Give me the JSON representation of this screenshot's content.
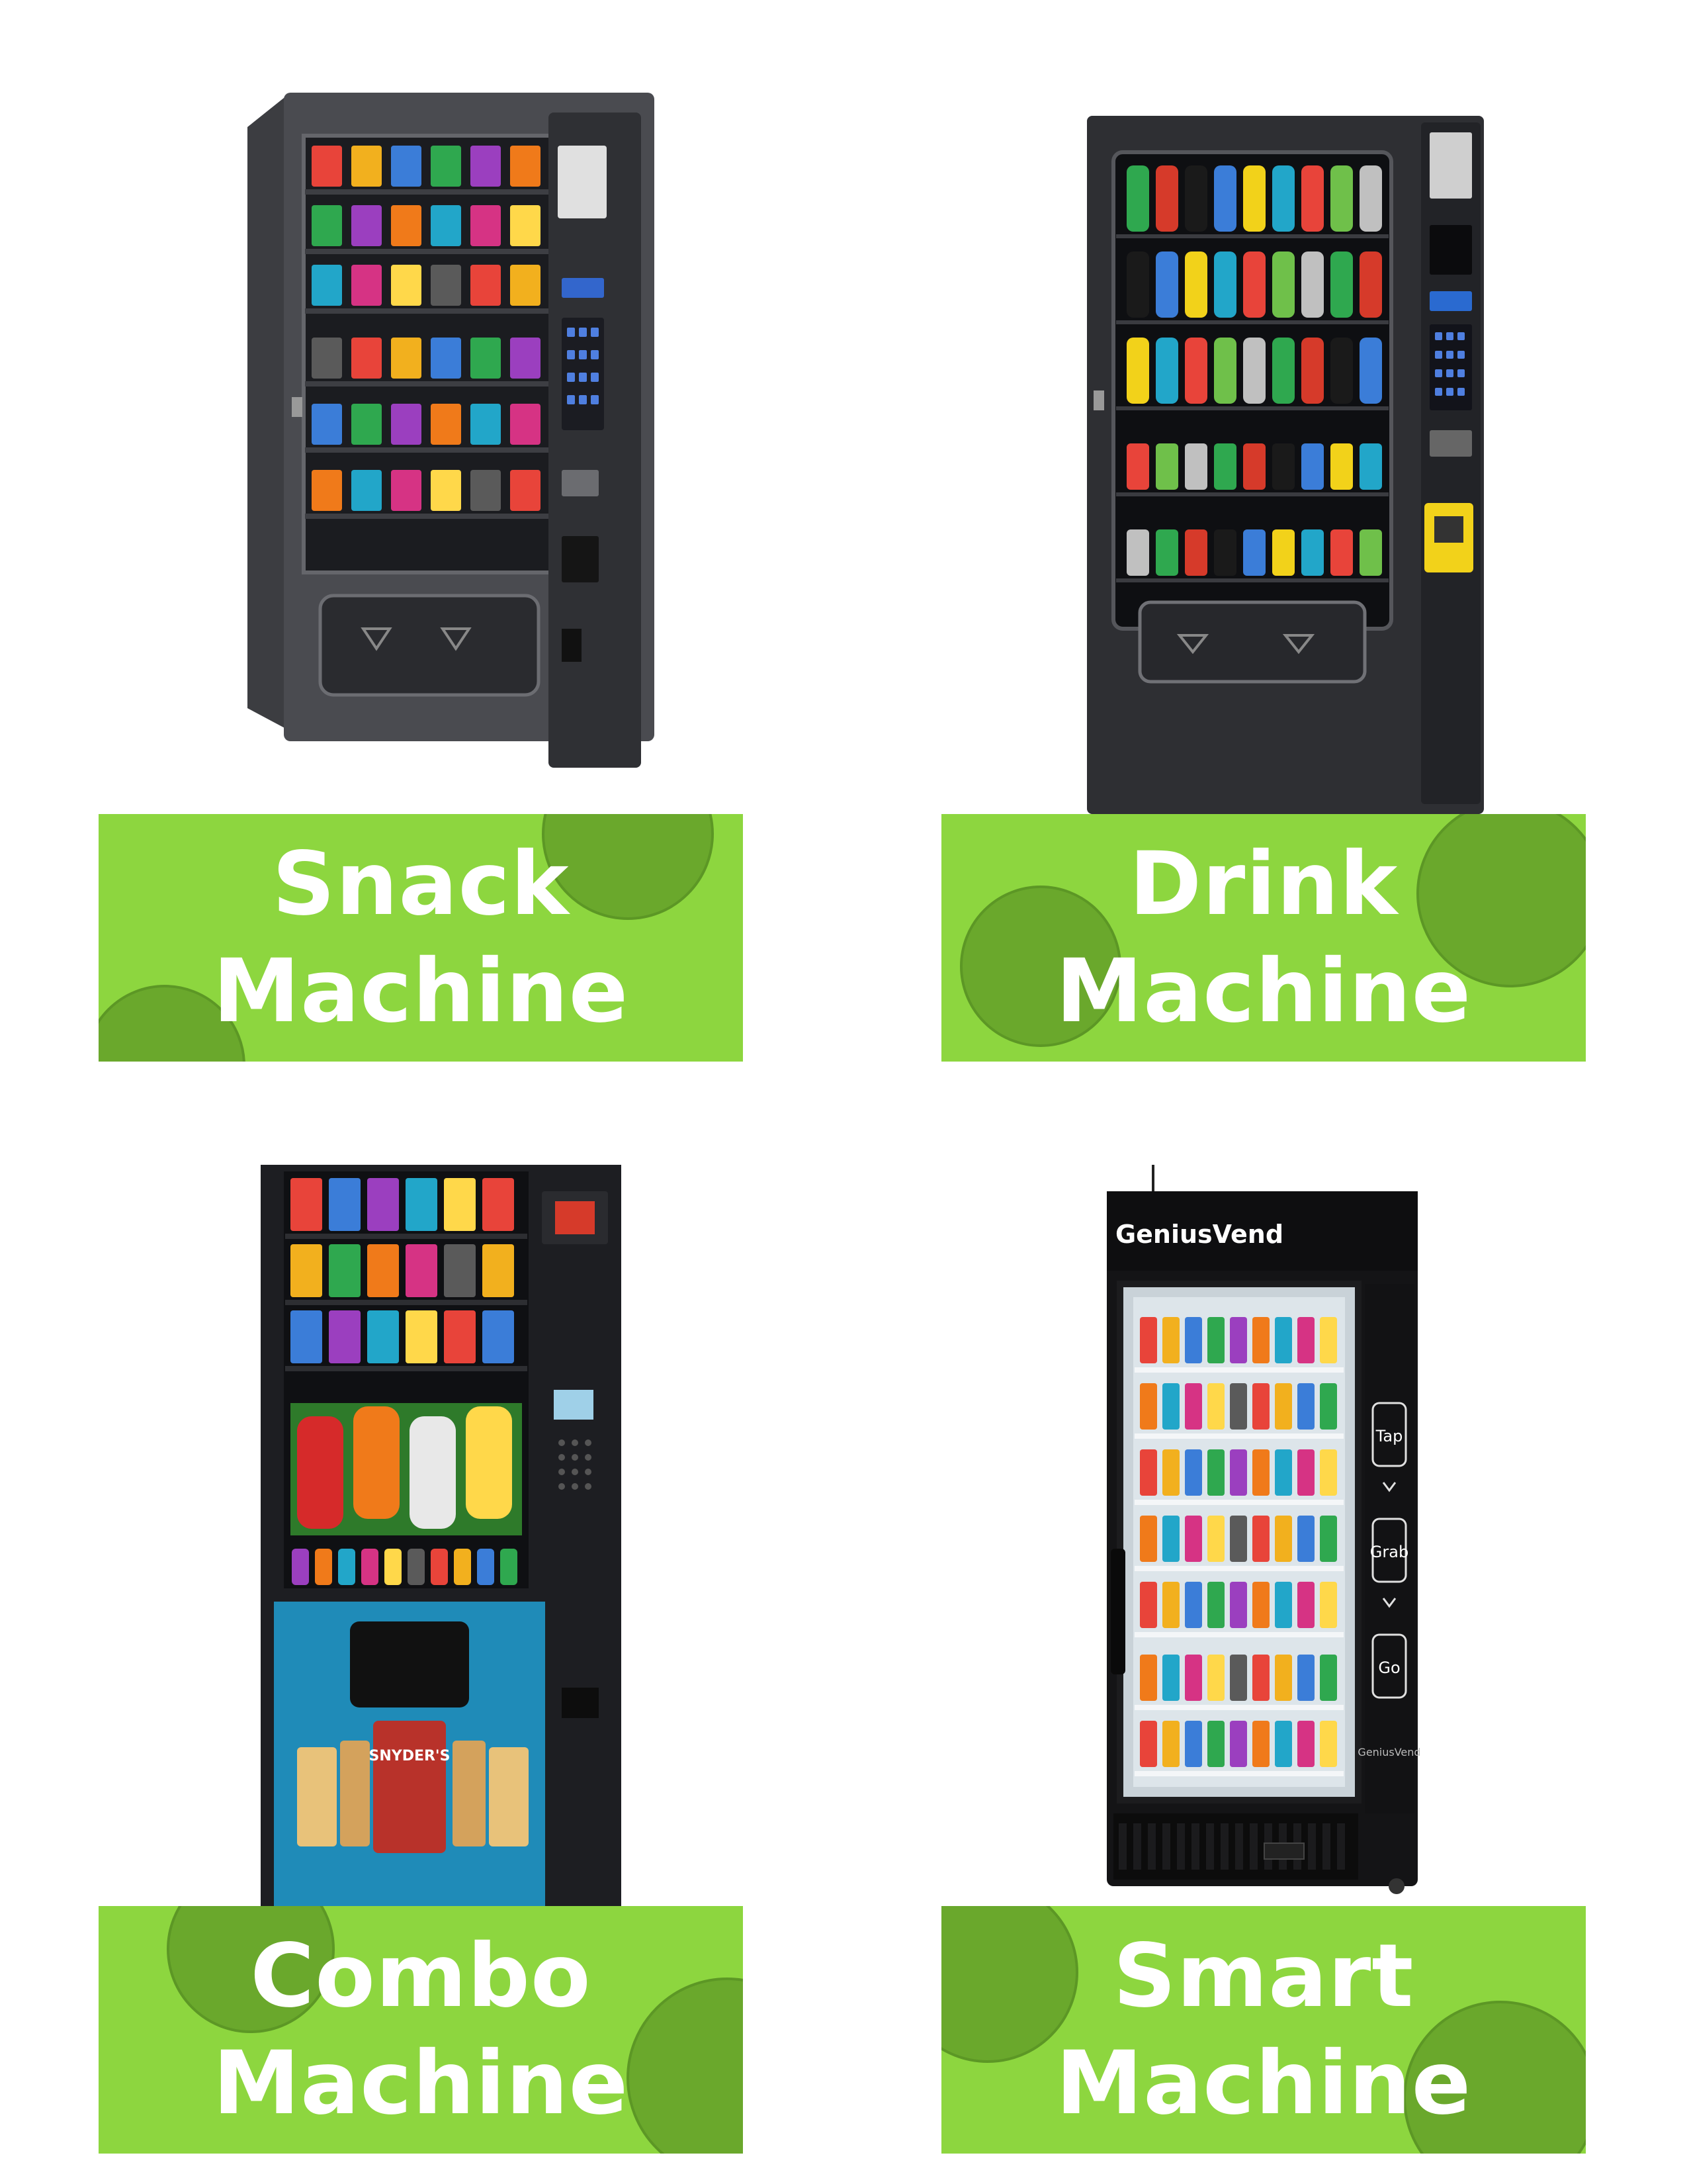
{
  "colors": {
    "label_green": "#8DD63F",
    "label_circle": "#6AA82C",
    "label_text": "#FFFFFF"
  },
  "machines": [
    {
      "id": "snack",
      "line1": "Snack",
      "line2": "Machine"
    },
    {
      "id": "drink",
      "line1": "Drink",
      "line2": "Machine"
    },
    {
      "id": "combo",
      "line1": "Combo",
      "line2": "Machine",
      "panel_brand": "SNYDER'S"
    },
    {
      "id": "smart",
      "line1": "Smart",
      "line2": "Machine",
      "brand": "GeniusVend",
      "steps": [
        "Tap",
        "Grab",
        "Go"
      ],
      "small_brand": "GeniusVend"
    }
  ]
}
